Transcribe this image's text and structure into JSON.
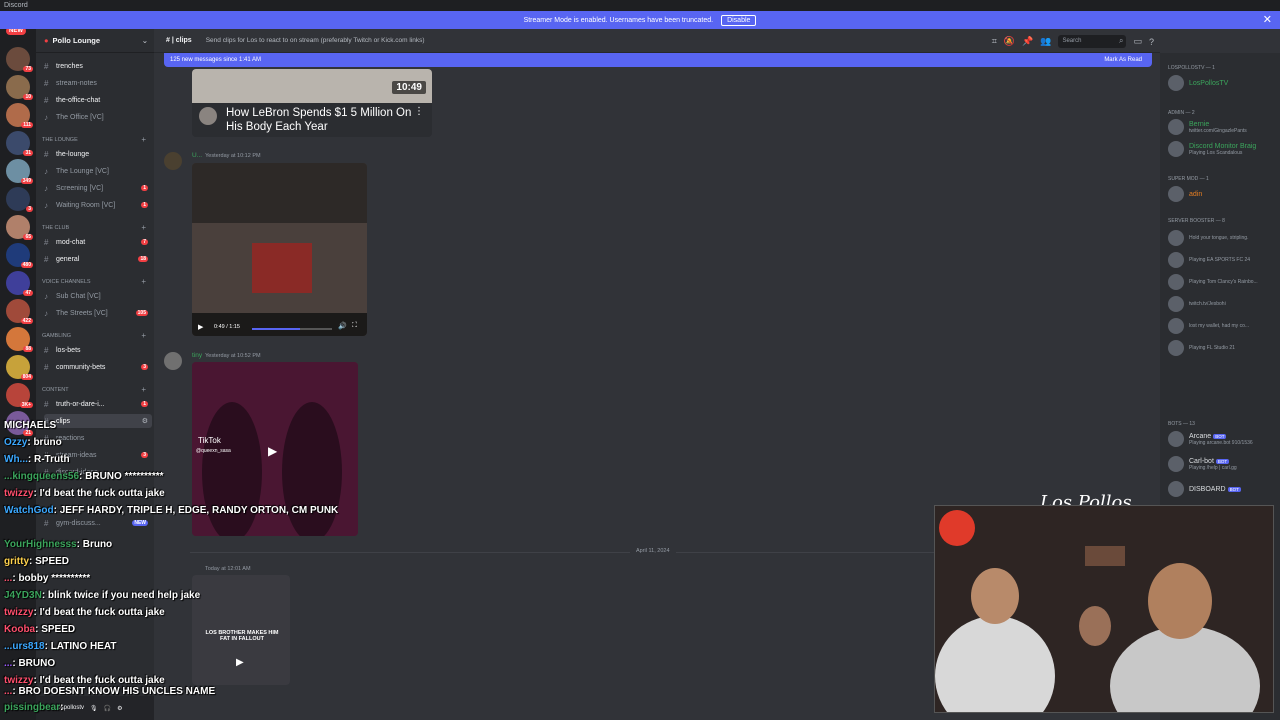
{
  "window": {
    "title": "Discord"
  },
  "banner": {
    "text": "Streamer Mode is enabled. Usernames have been truncated.",
    "button": "Disable",
    "close": "✕"
  },
  "servers": {
    "new_label": "NEW",
    "badges": [
      "73",
      "10",
      "111",
      "31",
      "349",
      "3",
      "65",
      "480",
      "47",
      "422",
      "88",
      "804",
      "3K+",
      "21"
    ]
  },
  "guild": {
    "name": "Pollo Lounge"
  },
  "channels": {
    "items": [
      {
        "name": "trenches",
        "badge": ""
      },
      {
        "name": "stream-notes",
        "badge": ""
      },
      {
        "name": "the-office-chat",
        "badge": ""
      },
      {
        "name": "The Office [VC]",
        "badge": ""
      },
      {
        "name": "the-lounge",
        "badge": ""
      },
      {
        "name": "The Lounge [VC]",
        "badge": ""
      },
      {
        "name": "Screening [VC]",
        "badge": "1"
      },
      {
        "name": "Waiting Room [VC]",
        "badge": "1"
      },
      {
        "name": "mod-chat",
        "badge": "7"
      },
      {
        "name": "general",
        "badge": "18"
      },
      {
        "name": "Sub Chat [VC]",
        "badge": ""
      },
      {
        "name": "The Streets [VC]",
        "badge": "105"
      },
      {
        "name": "los-bets",
        "badge": ""
      },
      {
        "name": "community-bets",
        "badge": "3"
      },
      {
        "name": "truth-or-dare-i...",
        "badge": "1"
      },
      {
        "name": "clips",
        "badge": ""
      },
      {
        "name": "reactions",
        "badge": ""
      },
      {
        "name": "stream-ideas",
        "badge": "3"
      },
      {
        "name": "discord-ideas",
        "badge": ""
      },
      {
        "name": "gym-discuss...",
        "badge": "NEW"
      }
    ],
    "categories": [
      "The Lounge",
      "The Club",
      "Voice Channels",
      "Gambling",
      "Content"
    ]
  },
  "chat_header": {
    "channel": "clips",
    "topic": "Send clips for Los to react to on stream (preferably Twitch or Kick.com links)",
    "search_placeholder": "Search"
  },
  "new_messages": {
    "text": "125 new messages since 1:41 AM",
    "action": "Mark As Read"
  },
  "messages": [
    {
      "embed_title": "How LeBron Spends $1 5 Million On His Body Each Year",
      "duration": "10:49"
    },
    {
      "user": "U...",
      "time": "Yesterday at 10:12 PM",
      "video_time": "0:49 / 1:15"
    },
    {
      "user": "tiny",
      "time": "Yesterday at 10:52 PM",
      "tiktok": "TikTok",
      "tiktok_handle": "@queexn_sasa"
    },
    {
      "date": "April 11, 2024"
    },
    {
      "user": "",
      "time": "Today at 12:01 AM",
      "caption": "LOS BROTHER MAKES HIM FAT IN FALLOUT"
    }
  ],
  "members": {
    "groups": [
      {
        "title": "LOSPOLLOSTV — 1"
      },
      {
        "title": "ADMIN — 2"
      },
      {
        "title": "SUPER MOD — 1"
      },
      {
        "title": "SERVER BOOSTER — 8"
      },
      {
        "title": "BOTS — 13"
      }
    ],
    "list": [
      {
        "name": "LosPollosTV",
        "sub": "",
        "color": "#3ba55c"
      },
      {
        "name": "Bernie",
        "sub": "twitter.com/GingazlePants",
        "color": "#3ba55c"
      },
      {
        "name": "Discord Monitor Braig",
        "sub": "Playing Los Scandalous",
        "color": "#3ba55c"
      },
      {
        "name": "adin",
        "sub": "",
        "color": "#e67e22"
      },
      {
        "name": "Arcane",
        "sub": "Playing arcane.bot 910/1536",
        "color": "#dbdee1"
      },
      {
        "name": "Carl-bot",
        "sub": "Playing /help | carl.gg",
        "color": "#dbdee1"
      },
      {
        "name": "DISBOARD",
        "sub": "",
        "color": "#dbdee1"
      }
    ],
    "bot_label": "BOT",
    "booster_subs": [
      "Hold your tongue, stripling.",
      "Playing EA SPORTS FC 24",
      "Playing Tom Clancy's Rainbo...",
      "twitch.tv/Jesbohi",
      "lost my wallet, had my co...",
      "Playing FL Studio 21"
    ]
  },
  "stream_chat": [
    {
      "user": "MICHAELS",
      "text": ""
    },
    {
      "user": "Ozzy",
      "text": "bruno"
    },
    {
      "user": "Wh...",
      "text": "R-Truth"
    },
    {
      "user": "...kingqueens56",
      "text": "BRUNO **********"
    },
    {
      "user": "twizzy",
      "text": "I'd beat the fuck outta jake"
    },
    {
      "user": "WatchGod",
      "text": "JEFF HARDY, TRIPLE H, EDGE, RANDY ORTON, CM PUNK"
    },
    {
      "user": "YourHighnesss",
      "text": "Bruno"
    },
    {
      "user": "gritty",
      "text": "SPEED"
    },
    {
      "user": "...",
      "text": "bobby **********"
    },
    {
      "user": "J4YD3N",
      "text": "blink twice if you need help jake"
    },
    {
      "user": "twizzy",
      "text": "I'd beat the fuck outta jake"
    },
    {
      "user": "Kooba",
      "text": "SPEED"
    },
    {
      "user": "...urs818",
      "text": "LATINO HEAT"
    },
    {
      "user": "...",
      "text": "BRUNO"
    },
    {
      "user": "twizzy",
      "text": "I'd beat the fuck outta jake"
    },
    {
      "user": "...",
      "text": "BRO DOESNT KNOW HIS UNCLES NAME"
    },
    {
      "user": "pissingbear",
      "text": ""
    }
  ],
  "overlay": {
    "signature": "Los Pollos"
  },
  "user_panel": {
    "name": "lospollostv"
  },
  "colors": {
    "accent": "#5865f2",
    "danger": "#f23f43",
    "bg": "#313338"
  }
}
